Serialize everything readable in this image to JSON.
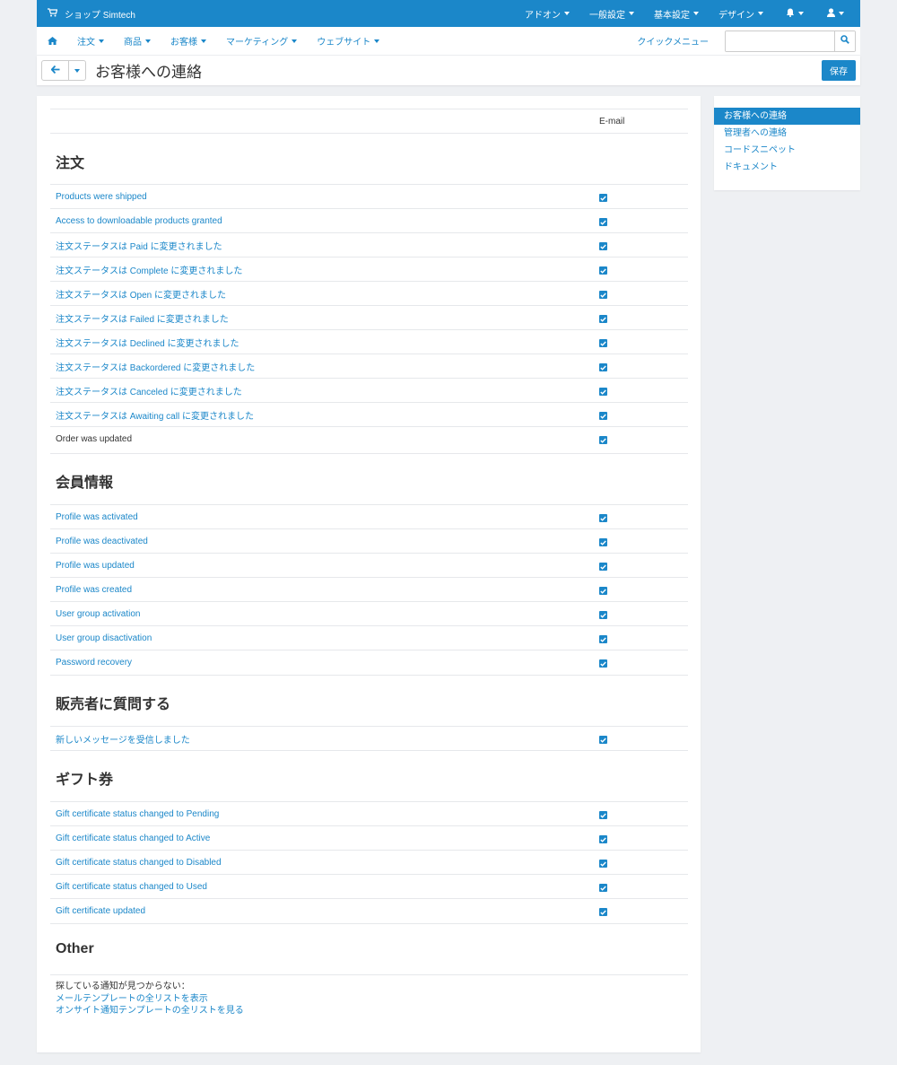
{
  "colors": {
    "accent": "#1b87c9",
    "background": "#eef0f3"
  },
  "topbar": {
    "brand_icon": "cart-icon",
    "brand": "ショップ  Simtech",
    "menus": [
      "アドオン",
      "一般設定",
      "基本設定",
      "デザイン"
    ],
    "bell_icon": "bell-icon",
    "user_icon": "user-icon"
  },
  "subnav": {
    "home_icon": "home-icon",
    "items": [
      "注文",
      "商品",
      "お客様",
      "マーケティング",
      "ウェブサイト"
    ],
    "quick_menu": "クイックメニュー",
    "search_value": "",
    "search_icon": "search-icon"
  },
  "titlebar": {
    "title": "お客様への連絡",
    "save": "保存"
  },
  "table": {
    "email_header": "E-mail"
  },
  "sections": {
    "orders": {
      "title": "注文",
      "rows": [
        "Products were shipped",
        "Access to downloadable products granted",
        "注文ステータスは Paid に変更されました",
        "注文ステータスは Complete に変更されました",
        "注文ステータスは Open に変更されました",
        "注文ステータスは Failed に変更されました",
        "注文ステータスは Declined に変更されました",
        "注文ステータスは Backordered に変更されました",
        "注文ステータスは Canceled に変更されました",
        "注文ステータスは Awaiting call に変更されました",
        "Order was updated"
      ]
    },
    "members": {
      "title": "会員情報",
      "rows": [
        "Profile was activated",
        "Profile was deactivated",
        "Profile was updated",
        "Profile was created",
        "User group activation",
        "User group disactivation",
        "Password recovery"
      ]
    },
    "vendor": {
      "title": "販売者に質問する",
      "rows": [
        "新しいメッセージを受信しました"
      ]
    },
    "gift": {
      "title": "ギフト券",
      "rows": [
        "Gift certificate status changed to Pending",
        "Gift certificate status changed to Active",
        "Gift certificate status changed to Disabled",
        "Gift certificate status changed to Used",
        "Gift certificate updated"
      ]
    },
    "other": {
      "title": "Other",
      "intro": "探している通知が見つからない：",
      "link1": "メールテンプレートの全リストを表示",
      "link2": "オンサイト通知テンプレートの全リストを見る"
    }
  },
  "sidebar": {
    "items": [
      "お客様への連絡",
      "管理者への連絡",
      "コードスニペット",
      "ドキュメント"
    ]
  }
}
